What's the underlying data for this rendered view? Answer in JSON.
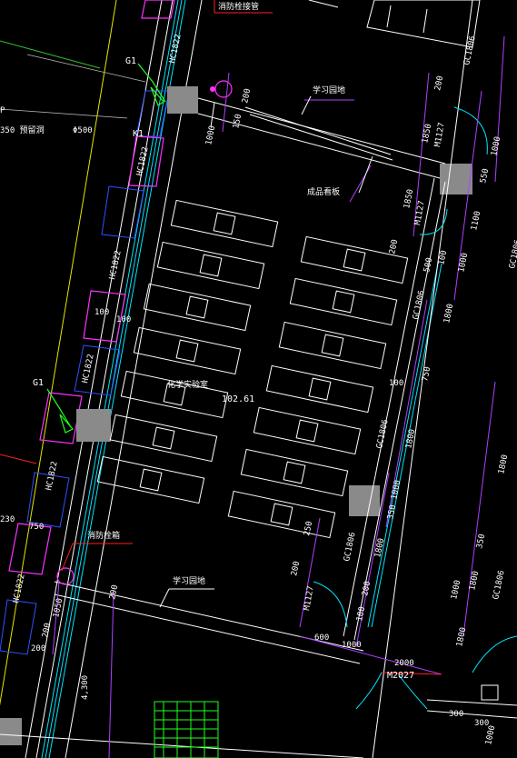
{
  "labels": {
    "fire_hydrant_top": "消防栓接管",
    "study_area_top": "学习园地",
    "display_board": "成品看板",
    "room_name": "化学实验室",
    "elevation": "102.61",
    "fire_hydrant_bottom": "消防栓箱",
    "study_area_bottom": "学习园地",
    "g1_top": "G1",
    "g1_mid": "G1",
    "k1": "K1",
    "p_label": "P",
    "hole_350": "350 预留洞",
    "phi500": "Φ500",
    "door_m2027": "M2027",
    "door_m1127_top": "M1127",
    "door_m1127_mid": "M1127",
    "door_m1127_bottom": "M1127",
    "win_hc1822_a": "HC1822",
    "win_hc1822_b": "HC1822",
    "win_hc1822_c": "HC1822",
    "win_hc1822_d": "HC1822",
    "win_hc1822_e": "HC1822",
    "win_hc1822_f": "HC1822",
    "win_gc1806_a": "GC1806",
    "win_gc1806_b": "GC1806",
    "win_gc1806_c": "GC1806",
    "win_gc1806_d": "GC1806",
    "win_gc1806_e": "GC1806",
    "win_gc1806_f": "GC1806"
  },
  "dimensions": {
    "d200_a": "200",
    "d150": "150",
    "d1000_a": "1000",
    "d200_b": "200",
    "d1850": "1850",
    "d1000_b": "1000",
    "d550": "550",
    "d1850_b": "1850",
    "d1100": "1100",
    "d200_c": "200",
    "d500": "500",
    "d100_a": "100",
    "d1000_c": "1000",
    "d1800_a": "1800",
    "d100_b": "100",
    "d100_c": "100",
    "d100_d": "100",
    "d750_a": "750",
    "d1800_b": "1800",
    "d1000_d": "1000",
    "d350_a": "350",
    "d1800_c": "1800",
    "d750_b": "750",
    "d250": "250",
    "d200_d": "200",
    "d200_e": "200",
    "d100_e": "100",
    "d600": "600",
    "d1000_e": "1000",
    "d2000": "2000",
    "d1050": "1050",
    "d200_f": "200",
    "d200_g": "200",
    "d200_h": "200",
    "d4300": "4,300",
    "d230": "230",
    "d750_c": "750",
    "d1800_d": "1800",
    "d350_b": "350",
    "d1800_e": "1800",
    "d1800_f": "1800",
    "d1000_f": "1000",
    "d300_a": "300",
    "d300_b": "300",
    "d1000_g": "1000"
  }
}
